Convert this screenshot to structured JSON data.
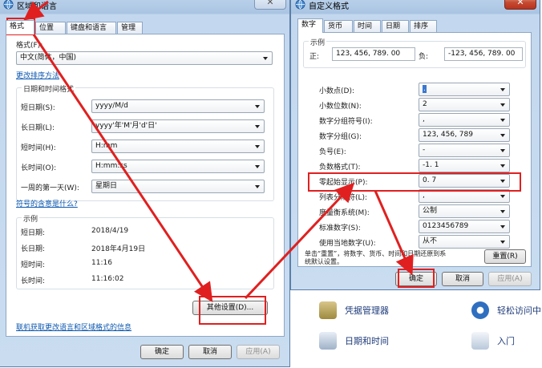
{
  "left_window": {
    "title": "区域和语言",
    "tabs": [
      "格式",
      "位置",
      "键盘和语言",
      "管理"
    ],
    "format_label": "格式(F):",
    "format_value": "中文(简体，中国)",
    "change_sort_link": "更改排序方法",
    "datetime_group": "日期和时间格式",
    "rows": [
      {
        "label": "短日期(S):",
        "value": "yyyy/M/d"
      },
      {
        "label": "长日期(L):",
        "value": "yyyy'年'M'月'd'日'"
      },
      {
        "label": "短时间(H):",
        "value": "H:mm"
      },
      {
        "label": "长时间(O):",
        "value": "H:mm:ss"
      },
      {
        "label": "一周的第一天(W):",
        "value": "星期日"
      }
    ],
    "symbols_link": "符号的含意是什么?",
    "example_group": "示例",
    "examples": [
      {
        "label": "短日期:",
        "value": "2018/4/19"
      },
      {
        "label": "长日期:",
        "value": "2018年4月19日"
      },
      {
        "label": "短时间:",
        "value": "11:16"
      },
      {
        "label": "长时间:",
        "value": "11:16:02"
      }
    ],
    "other_settings_button": "其他设置(D)...",
    "online_link": "联机获取更改语言和区域格式的信息",
    "ok": "确定",
    "cancel": "取消",
    "apply": "应用(A)"
  },
  "right_window": {
    "title": "自定义格式",
    "tabs": [
      "数字",
      "货币",
      "时间",
      "日期",
      "排序"
    ],
    "example_group": "示例",
    "positive_label": "正:",
    "positive_value": "123, 456, 789. 00",
    "negative_label": "负:",
    "negative_value": "-123, 456, 789. 00",
    "rows": [
      {
        "label": "小数点(D):",
        "value": "."
      },
      {
        "label": "小数位数(N):",
        "value": "2"
      },
      {
        "label": "数字分组符号(I):",
        "value": ","
      },
      {
        "label": "数字分组(G):",
        "value": "123, 456, 789"
      },
      {
        "label": "负号(E):",
        "value": "-"
      },
      {
        "label": "负数格式(T):",
        "value": "-1. 1"
      },
      {
        "label": "零起始显示(P):",
        "value": "0. 7"
      },
      {
        "label": "列表分隔符(L):",
        "value": ","
      },
      {
        "label": "度量衡系统(M):",
        "value": "公制"
      },
      {
        "label": "标准数字(S):",
        "value": "0123456789"
      },
      {
        "label": "使用当地数字(U):",
        "value": "从不"
      }
    ],
    "reset_hint_1": "单击“重置”，将数字、货币、时间和日期还原到系",
    "reset_hint_2": "统默认设置。",
    "reset_button": "重置(R)",
    "ok": "确定",
    "cancel": "取消",
    "apply": "应用(A)"
  },
  "control_panel": {
    "items": [
      "凭据管理器",
      "轻松访问中",
      "日期和时间",
      "入门"
    ]
  },
  "colors": {
    "annotation": "#e02020",
    "link": "#0b57b0",
    "window_frame": "#a9c4e2"
  }
}
